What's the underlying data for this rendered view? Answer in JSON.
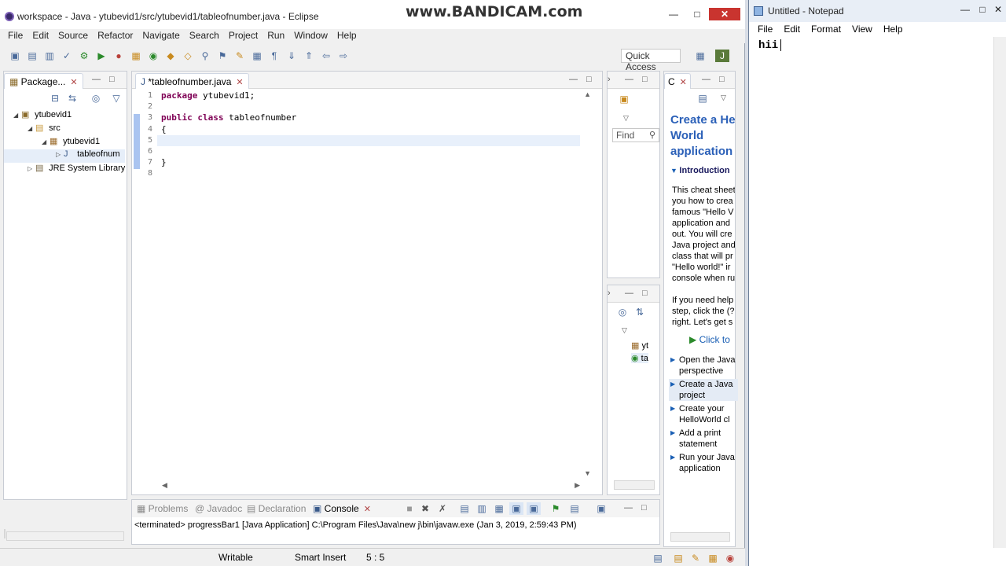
{
  "eclipse": {
    "title": "workspace - Java - ytubevid1/src/ytubevid1/tableofnumber.java - Eclipse",
    "watermark": "www.BANDICAM.com",
    "menu": [
      "File",
      "Edit",
      "Source",
      "Refactor",
      "Navigate",
      "Search",
      "Project",
      "Run",
      "Window",
      "Help"
    ],
    "quick_access": "Quick Access",
    "package_explorer": {
      "tab_label": "Package...",
      "tree": [
        {
          "label": "ytubevid1",
          "icon": "project-icon"
        },
        {
          "label": "src",
          "icon": "folder-icon"
        },
        {
          "label": "ytubevid1",
          "icon": "package-icon"
        },
        {
          "label": "tableofnum",
          "icon": "java-file-icon"
        },
        {
          "label": "JRE System Library",
          "icon": "library-icon"
        }
      ]
    },
    "editor": {
      "tab_label": "*tableofnumber.java",
      "lines": [
        {
          "n": "1",
          "parts": [
            [
              "kw",
              "package"
            ],
            [
              "t",
              " ytubevid1;"
            ]
          ]
        },
        {
          "n": "2",
          "parts": []
        },
        {
          "n": "3",
          "parts": [
            [
              "kw",
              "public"
            ],
            [
              "t",
              " "
            ],
            [
              "kw",
              "class"
            ],
            [
              "t",
              " tableofnumber"
            ]
          ]
        },
        {
          "n": "4",
          "parts": [
            [
              "t",
              "{"
            ]
          ]
        },
        {
          "n": "5",
          "parts": []
        },
        {
          "n": "6",
          "parts": []
        },
        {
          "n": "7",
          "parts": [
            [
              "t",
              "}"
            ]
          ]
        },
        {
          "n": "8",
          "parts": []
        }
      ]
    },
    "outline": {
      "find_placeholder": "Find",
      "items": [
        "yt",
        "ta"
      ]
    },
    "cheat_sheet": {
      "tab_label": "C",
      "title": "Create a He World application",
      "intro": "Introduction",
      "body": [
        "This cheat sheet",
        "you how to crea",
        "famous \"Hello V",
        "application and",
        "out. You will cre",
        "Java project and",
        "class that will pr",
        "\"Hello world!\" ir",
        "console when ru",
        "",
        "If you need help",
        "step, click the (?",
        "right. Let's get s"
      ],
      "click_to": "Click to",
      "steps": [
        {
          "label": "Open the Java perspective"
        },
        {
          "label": "Create a Java project"
        },
        {
          "label": "Create your HelloWorld cl"
        },
        {
          "label": "Add a print statement"
        },
        {
          "label": "Run your Java application"
        }
      ]
    },
    "console": {
      "tabs": [
        "Problems",
        "Javadoc",
        "Declaration",
        "Console"
      ],
      "output": "<terminated> progressBar1 [Java Application] C:\\Program Files\\Java\\new j\\bin\\javaw.exe (Jan 3, 2019, 2:59:43 PM)"
    },
    "status": {
      "writable": "Writable",
      "insert_mode": "Smart Insert",
      "position": "5 : 5"
    }
  },
  "notepad": {
    "title": "Untitled - Notepad",
    "menu": [
      "File",
      "Edit",
      "Format",
      "View",
      "Help"
    ],
    "text": "hii"
  }
}
